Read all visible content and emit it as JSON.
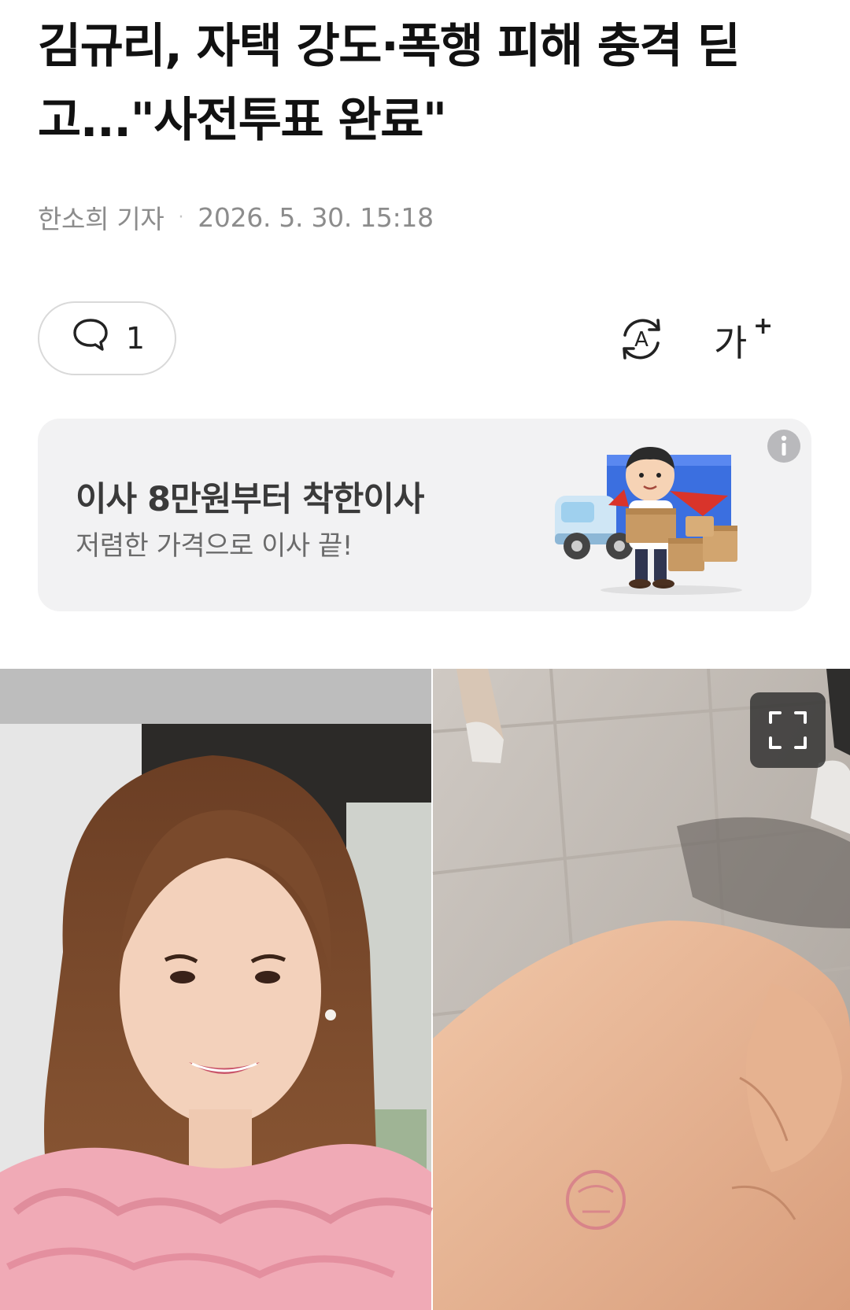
{
  "article": {
    "title": "김규리, 자택 강도·폭행 피해 충격 딛고...\"사전투표 완료\"",
    "reporter": "한소희 기자",
    "separator": "·",
    "datetime": "2026. 5. 30. 15:18",
    "comment_count": "1"
  },
  "toolbar": {
    "comment_icon": "speech-bubble-icon",
    "translate_icon": "auto-translate-icon",
    "translate_glyph": "A",
    "font_size_icon": "font-size-icon",
    "font_size_glyph": "가",
    "font_size_plus": "+"
  },
  "ad": {
    "title": "이사 8만원부터 착한이사",
    "subtitle": "저렴한 가격으로 이사 끝!",
    "info_icon": "info-icon",
    "illustration": "moving-mascot-with-truck-and-boxes"
  },
  "photos": {
    "left_image": "selfie-woman-pink-dress",
    "right_image": "hand-with-voting-stamp-on-sidewalk",
    "expand_icon": "expand-icon"
  },
  "colors": {
    "text_primary": "#111111",
    "text_meta": "#8c8c8c",
    "ad_background": "#f2f2f3",
    "ad_title": "#3a3a3a",
    "ad_subtitle": "#6b6b6b"
  }
}
